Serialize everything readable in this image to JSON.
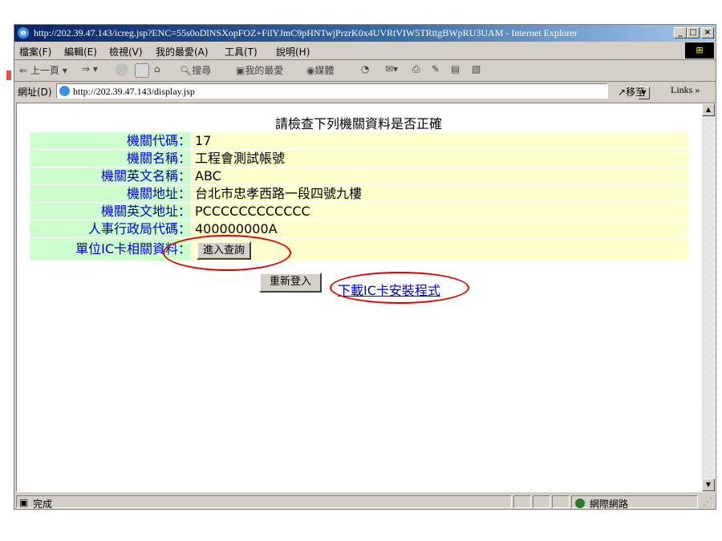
{
  "window": {
    "title": "http://202.39.47.143/icreg.jsp?ENC=55s0oDlNSXopFOZ+FilYJmC9pHNTwjPrzrK0x4UVRtVIW5TRttgBWpRU3UAM - Internet Explorer",
    "controls": [
      "_",
      "□",
      "×"
    ]
  },
  "menu": [
    "檔案(F)",
    "編輯(E)",
    "檢視(V)",
    "我的最愛(A)",
    "工具(T)",
    "說明(H)"
  ],
  "toolbar": {
    "back": "上一頁",
    "search": "搜尋",
    "favorites": "我的最愛",
    "media": "媒體"
  },
  "address": {
    "label": "網址(D)",
    "url": "http://202.39.47.143/display.jsp",
    "go": "移至",
    "links": "Links »"
  },
  "page": {
    "title": "請檢查下列機關資料是否正確",
    "rows": [
      {
        "label": "機關代碼：",
        "value": "17"
      },
      {
        "label": "機關名稱：",
        "value": "工程會測試帳號"
      },
      {
        "label": "機關英文名稱：",
        "value": "ABC"
      },
      {
        "label": "機關地址：",
        "value": "台北市忠孝西路一段四號九樓"
      },
      {
        "label": "機關英文地址：",
        "value": "PCCCCCCCCCCCC"
      },
      {
        "label": "人事行政局代碼：",
        "value": "400000000A"
      }
    ],
    "ic_row_label": "單位IC卡相關資料：",
    "query_button": "進入查詢",
    "relogin_button": "重新登入",
    "download_link": "下載IC卡安裝程式"
  },
  "status": {
    "text": "完成",
    "zone": "網際網路"
  },
  "colors": {
    "label_bg": "#ccffcc",
    "value_bg": "#ffffcc",
    "label_text": "#0000cc",
    "highlight": "#e00000"
  }
}
